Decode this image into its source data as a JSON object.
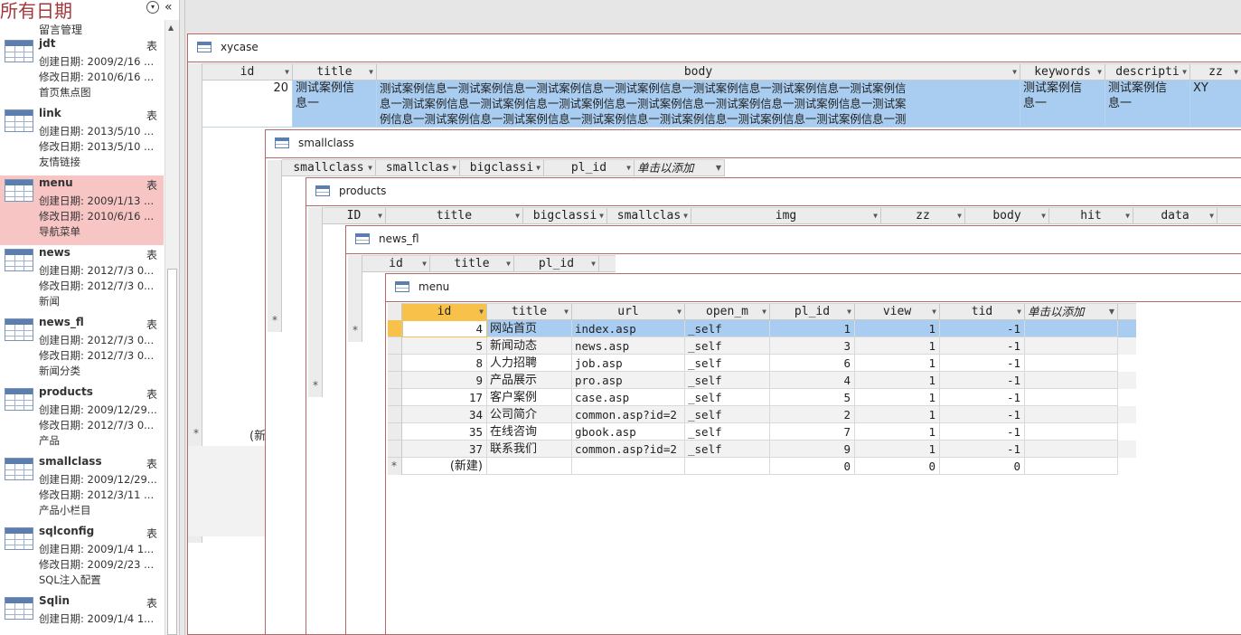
{
  "nav": {
    "title": "所有日期",
    "dropdown_glyph": "▾",
    "collapse_glyph": "«",
    "top_desc": "留言管理",
    "items": [
      {
        "name": "jdt",
        "type": "表",
        "created": "创建日期: 2009/2/16 ...",
        "modified": "修改日期: 2010/6/16 ...",
        "desc": "首页焦点图"
      },
      {
        "name": "link",
        "type": "表",
        "created": "创建日期: 2013/5/10 ...",
        "modified": "修改日期: 2013/5/10 ...",
        "desc": "友情链接"
      },
      {
        "name": "menu",
        "type": "表",
        "created": "创建日期: 2009/1/13 ...",
        "modified": "修改日期: 2010/6/16 ...",
        "desc": "导航菜单"
      },
      {
        "name": "news",
        "type": "表",
        "created": "创建日期: 2012/7/3 0...",
        "modified": "修改日期: 2012/7/3 0...",
        "desc": "新闻"
      },
      {
        "name": "news_fl",
        "type": "表",
        "created": "创建日期: 2012/7/3 0...",
        "modified": "修改日期: 2012/7/3 0...",
        "desc": "新闻分类"
      },
      {
        "name": "products",
        "type": "表",
        "created": "创建日期: 2009/12/29...",
        "modified": "修改日期: 2012/7/3 0...",
        "desc": "产品"
      },
      {
        "name": "smallclass",
        "type": "表",
        "created": "创建日期: 2009/12/29...",
        "modified": "修改日期: 2012/3/11 ...",
        "desc": "产品小栏目"
      },
      {
        "name": "sqlconfig",
        "type": "表",
        "created": "创建日期: 2009/1/4 1...",
        "modified": "修改日期: 2009/2/23 ...",
        "desc": "SQL注入配置"
      },
      {
        "name": "Sqlin",
        "type": "表",
        "created": "创建日期: 2009/1/4 1...",
        "modified": "",
        "desc": ""
      }
    ]
  },
  "windows": {
    "xycase": {
      "title": "xycase",
      "columns": [
        "id",
        "title",
        "body",
        "keywords",
        "descripti",
        "zz"
      ],
      "row": {
        "id": "20",
        "title_l1": "测试案例信",
        "title_l2": "息一",
        "body_l1": "测试案例信息一测试案例信息一测试案例信息一测试案例信息一测试案例信息一测试案例信息一测试案例信",
        "body_l2": "息一测试案例信息一测试案例信息一测试案例信息一测试案例信息一测试案例信息一测试案例信息一测试案",
        "body_l3": "例信息一测试案例信息一测试案例信息一测试案例信息一测试案例信息一测试案例信息一测试案例信息一测",
        "keywords_l1": "测试案例信",
        "keywords_l2": "息一",
        "descripti_l1": "测试案例信",
        "descripti_l2": "息一",
        "zz": "XY"
      },
      "new_row_star": "*",
      "new_row_label": "(新"
    },
    "smallclass": {
      "title": "smallclass",
      "columns": [
        "smallclass",
        "smallclas",
        "bigclassi",
        "pl_id",
        "单击以添加"
      ],
      "new_row_star": "*"
    },
    "products": {
      "title": "products",
      "columns": [
        "ID",
        "title",
        "bigclassi",
        "smallclas",
        "img",
        "zz",
        "body",
        "hit",
        "data"
      ],
      "new_row_star": "*"
    },
    "news_fl": {
      "title": "news_fl",
      "columns": [
        "id",
        "title",
        "pl_id"
      ],
      "new_row_star": "*"
    },
    "menu": {
      "title": "menu",
      "columns": [
        "id",
        "title",
        "url",
        "open_m",
        "pl_id",
        "view",
        "tid",
        "单击以添加"
      ],
      "rows": [
        {
          "id": "4",
          "title": "网站首页",
          "url": "index.asp",
          "open_m": "_self",
          "pl_id": "1",
          "view": "1",
          "tid": "-1"
        },
        {
          "id": "5",
          "title": "新闻动态",
          "url": "news.asp",
          "open_m": "_self",
          "pl_id": "3",
          "view": "1",
          "tid": "-1"
        },
        {
          "id": "8",
          "title": "人力招聘",
          "url": "job.asp",
          "open_m": "_self",
          "pl_id": "6",
          "view": "1",
          "tid": "-1"
        },
        {
          "id": "9",
          "title": "产品展示",
          "url": "pro.asp",
          "open_m": "_self",
          "pl_id": "4",
          "view": "1",
          "tid": "-1"
        },
        {
          "id": "17",
          "title": "客户案例",
          "url": "case.asp",
          "open_m": "_self",
          "pl_id": "5",
          "view": "1",
          "tid": "-1"
        },
        {
          "id": "34",
          "title": "公司简介",
          "url": "common.asp?id=2",
          "open_m": "_self",
          "pl_id": "2",
          "view": "1",
          "tid": "-1"
        },
        {
          "id": "35",
          "title": "在线咨询",
          "url": "gbook.asp",
          "open_m": "_self",
          "pl_id": "7",
          "view": "1",
          "tid": "-1"
        },
        {
          "id": "37",
          "title": "联系我们",
          "url": "common.asp?id=2",
          "open_m": "_self",
          "pl_id": "9",
          "view": "1",
          "tid": "-1"
        }
      ],
      "new_row": {
        "star": "*",
        "id": "(新建)",
        "pl_id": "0",
        "view": "0",
        "tid": "0"
      }
    }
  },
  "colors": {
    "accent": "#a4373a",
    "selected_item": "#f8c5c5",
    "selected_row": "#a9cdf0",
    "active_header": "#f8c24a"
  }
}
